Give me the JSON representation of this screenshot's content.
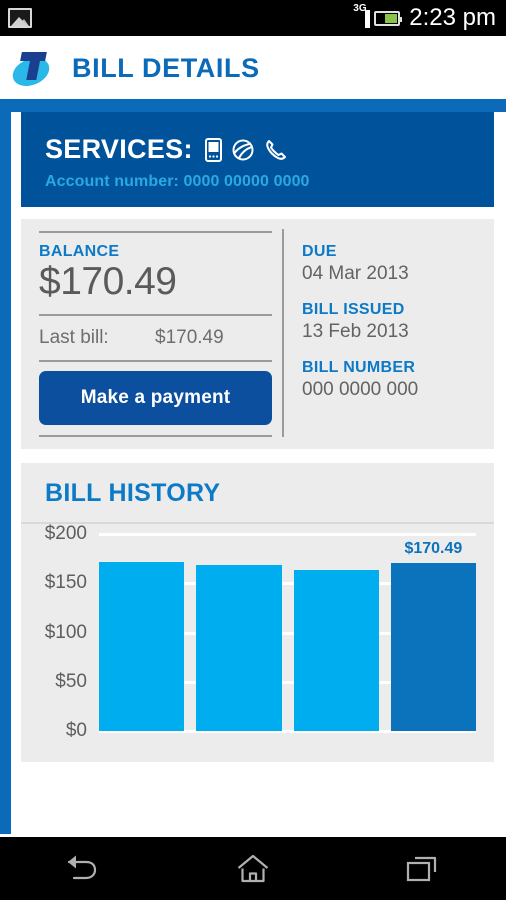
{
  "statusbar": {
    "gallery_icon": "gallery-icon",
    "network_type": "3G",
    "signal_icon": "signal-bars-icon",
    "battery_icon": "battery-icon",
    "time": "2:23 pm"
  },
  "appbar": {
    "logo_icon": "telstra-logo-icon",
    "title": "BILL DETAILS",
    "accent_color": "#0c6bb8"
  },
  "services": {
    "title": "SERVICES:",
    "icons": [
      {
        "name": "mobile-phone-icon",
        "label": "Mobile"
      },
      {
        "name": "internet-globe-icon",
        "label": "Internet"
      },
      {
        "name": "home-phone-icon",
        "label": "Home phone"
      }
    ],
    "account_label": "Account number:",
    "account_number": "0000 00000 0000",
    "account_line": "Account number: 0000 00000 0000",
    "background_color": "#00539b",
    "account_color": "#2aa9e0"
  },
  "bill_card": {
    "balance_label": "BALANCE",
    "balance_amount": "$170.49",
    "last_bill_label": "Last bill:",
    "last_bill_amount": "$170.49",
    "pay_button_label": "Make a payment",
    "details": [
      {
        "label": "DUE",
        "value": "04 Mar 2013"
      },
      {
        "label": "BILL ISSUED",
        "value": "13 Feb 2013"
      },
      {
        "label": "BILL NUMBER",
        "value": "000 0000 000"
      }
    ]
  },
  "bill_history": {
    "title": "BILL HISTORY"
  },
  "chart_data": {
    "type": "bar",
    "title": "BILL HISTORY",
    "xlabel": "",
    "ylabel": "",
    "ylim": [
      0,
      200
    ],
    "grid": true,
    "legend": false,
    "categories": [
      "",
      "",
      "",
      ""
    ],
    "values": [
      172,
      169,
      163,
      170.49
    ],
    "tick_labels": [
      "$200",
      "$150",
      "$100",
      "$50",
      "$0"
    ],
    "ticks": [
      200,
      150,
      100,
      50,
      0
    ],
    "bar_colors": [
      "#00aeef",
      "#00aeef",
      "#00aeef",
      "#0b72bc"
    ],
    "data_labels": [
      "",
      "",
      "",
      "$170.49"
    ],
    "highlight_index": 3,
    "highlight_label": "$170.49"
  },
  "navbar": {
    "buttons": [
      {
        "name": "back-button",
        "icon": "back-arrow-icon"
      },
      {
        "name": "home-button",
        "icon": "home-icon"
      },
      {
        "name": "recents-button",
        "icon": "recent-apps-icon"
      }
    ]
  }
}
